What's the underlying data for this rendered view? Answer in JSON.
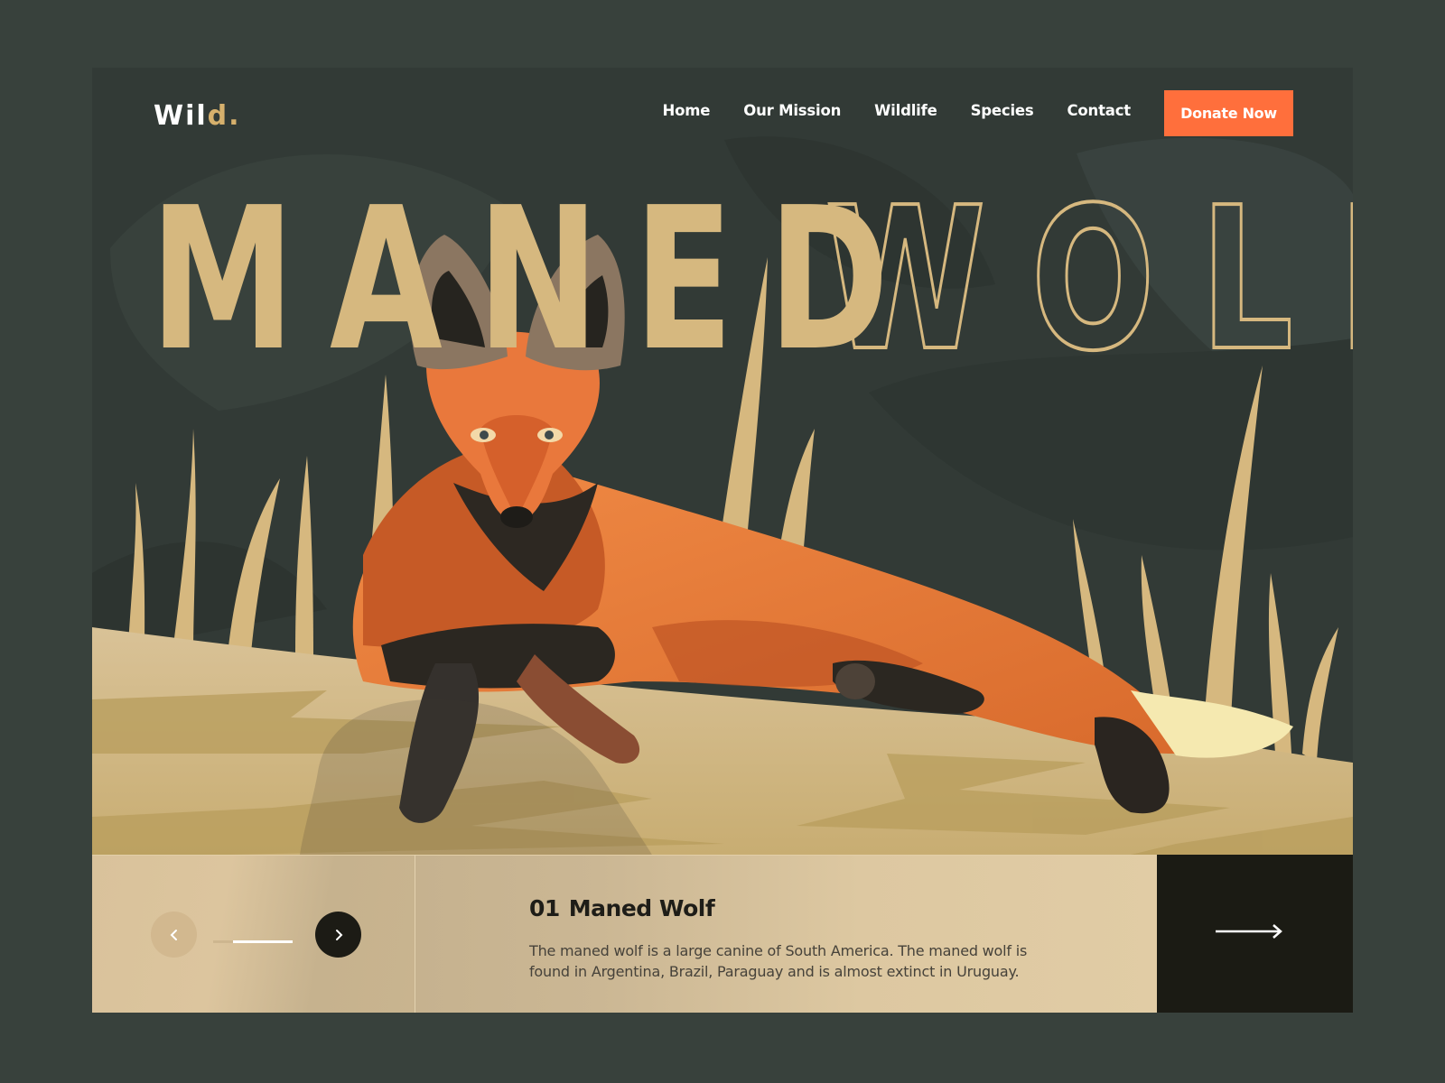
{
  "page": {
    "background": "#38413c",
    "frame_background": "#323a36"
  },
  "header": {
    "logo_main": "Wil",
    "logo_accent": "d.",
    "nav": [
      {
        "label": "Home"
      },
      {
        "label": "Our Mission"
      },
      {
        "label": "Wildlife"
      },
      {
        "label": "Species"
      },
      {
        "label": "Contact"
      }
    ],
    "donate_label": "Donate Now",
    "donate_color": "#ff6f3c"
  },
  "hero": {
    "headline_solid": "MANED",
    "headline_outline": "WOLF",
    "headline_color": "#d6b87f",
    "illustration": "maned-wolf-lying-in-grass"
  },
  "slider": {
    "prev_icon": "chevron-left-icon",
    "next_icon": "chevron-right-icon",
    "progress": 0.25,
    "slide_number": "01",
    "slide_title": "Maned Wolf",
    "description": "The maned wolf is a large canine of South America. The maned wolf is found in Argentina, Brazil, Paraguay and is almost extinct in Uruguay.",
    "go_icon": "arrow-right-icon"
  }
}
